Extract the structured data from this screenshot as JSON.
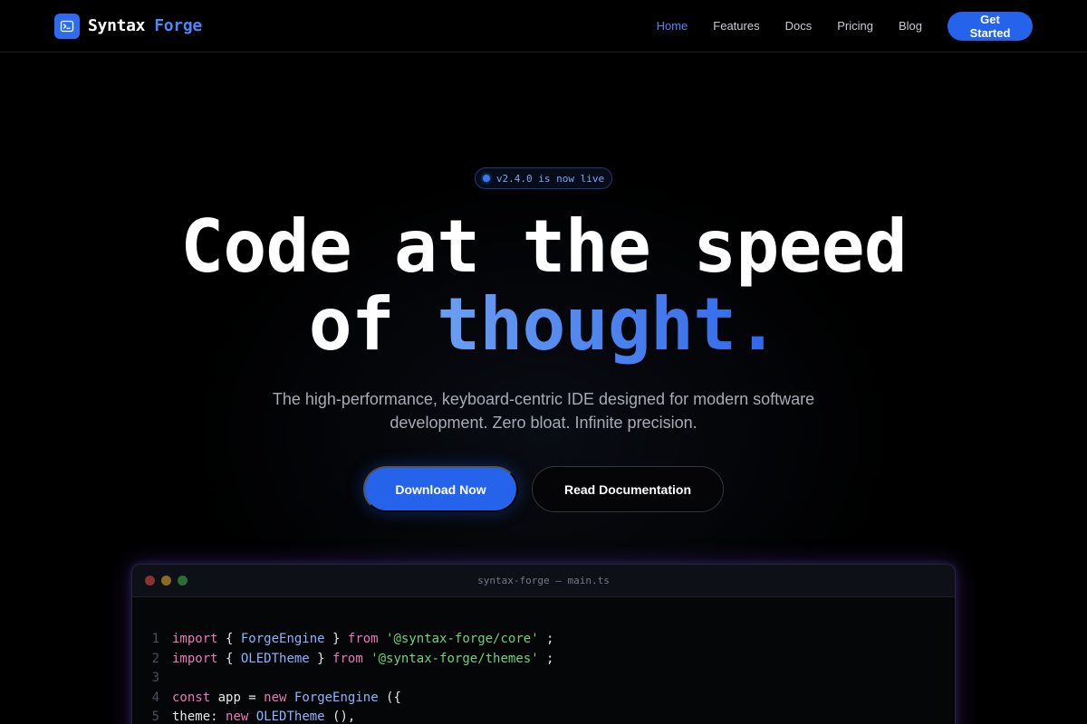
{
  "nav": {
    "brand_part1": "Syntax",
    "brand_part2": "Forge",
    "links": [
      "Home",
      "Features",
      "Docs",
      "Pricing",
      "Blog"
    ],
    "active_link": "Home",
    "cta_label": "Get Started"
  },
  "hero": {
    "badge_text": "v2.4.0 is now live",
    "headline_line1": "Code at the speed",
    "headline_line2_plain": "of",
    "headline_line2_accent": "thought.",
    "subtitle": "The high-performance, keyboard-centric IDE designed for modern software development. Zero bloat. Infinite precision.",
    "primary_button": "Download Now",
    "secondary_button": "Read Documentation"
  },
  "editor": {
    "title": "syntax-forge — main.ts",
    "lines": [
      {
        "num": "1",
        "tokens": [
          [
            "kw",
            "import"
          ],
          [
            "p",
            " { "
          ],
          [
            "id",
            "ForgeEngine"
          ],
          [
            "p",
            " } "
          ],
          [
            "kw",
            "from"
          ],
          [
            "p",
            " "
          ],
          [
            "str",
            "'@syntax-forge/core'"
          ],
          [
            "p",
            " ;"
          ]
        ]
      },
      {
        "num": "2",
        "tokens": [
          [
            "kw",
            "import"
          ],
          [
            "p",
            " { "
          ],
          [
            "id",
            "OLEDTheme"
          ],
          [
            "p",
            " } "
          ],
          [
            "kw",
            "from"
          ],
          [
            "p",
            " "
          ],
          [
            "str",
            "'@syntax-forge/themes'"
          ],
          [
            "p",
            " ;"
          ]
        ]
      },
      {
        "num": "3",
        "tokens": []
      },
      {
        "num": "4",
        "tokens": [
          [
            "kw",
            "const"
          ],
          [
            "w",
            " app = "
          ],
          [
            "kw",
            "new"
          ],
          [
            "p",
            " "
          ],
          [
            "id",
            "ForgeEngine"
          ],
          [
            "p",
            " ({"
          ]
        ]
      },
      {
        "num": "5",
        "tokens": [
          [
            "w",
            "theme: "
          ],
          [
            "kw",
            "new"
          ],
          [
            "p",
            " "
          ],
          [
            "id",
            "OLEDTheme"
          ],
          [
            "p",
            " (),"
          ]
        ]
      }
    ]
  },
  "colors": {
    "accent": "#2563eb",
    "accent_light": "#4d86f5",
    "background": "#000000"
  },
  "icons": {
    "logo": "terminal-icon"
  }
}
